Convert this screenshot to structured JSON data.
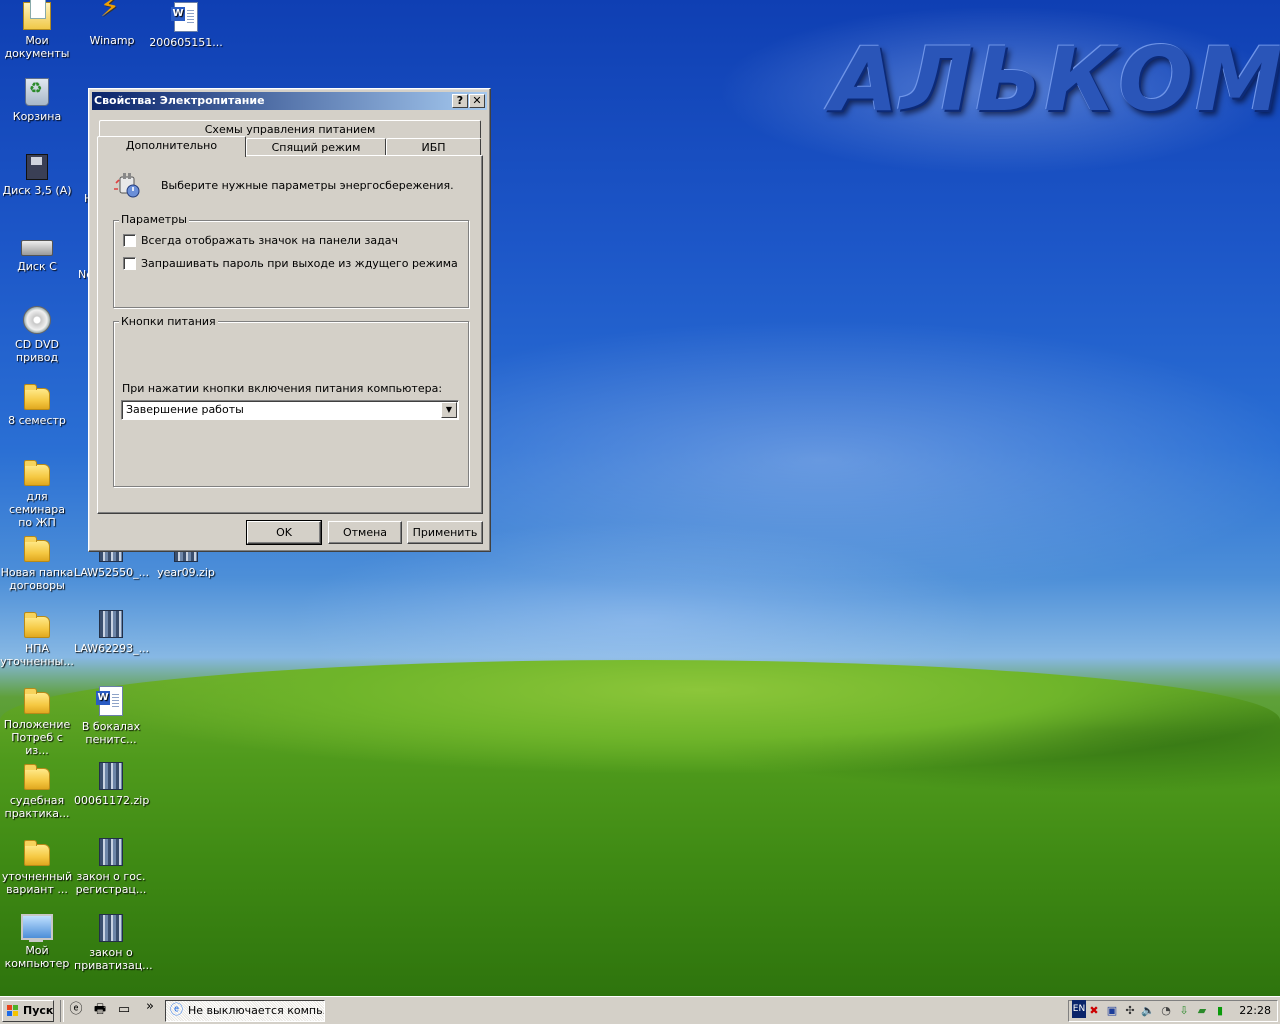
{
  "desktop": {
    "brand_text": "АЛЬКОМ",
    "icons": [
      {
        "label": "Мои\nдокументы",
        "icon": "my-documents-icon"
      },
      {
        "label": "Winamp",
        "icon": "winamp-icon"
      },
      {
        "label": "200605151...",
        "icon": "word-document-icon"
      },
      {
        "label": "Корзина",
        "icon": "recycle-bin-icon"
      },
      {
        "label": "Диск 3,5 (A)",
        "icon": "floppy-drive-icon"
      },
      {
        "label": "Диск C",
        "icon": "hard-drive-icon"
      },
      {
        "label": "CD DVD\nпривод",
        "icon": "cd-drive-icon"
      },
      {
        "label": "8 семестр",
        "icon": "folder-icon"
      },
      {
        "label": "для семинара\nпо ЖП",
        "icon": "folder-icon"
      },
      {
        "label": "Новая папка\nдоговоры",
        "icon": "folder-icon"
      },
      {
        "label": "LAW52550_...",
        "icon": "archive-icon"
      },
      {
        "label": "year09.zip",
        "icon": "archive-icon"
      },
      {
        "label": "НПА\nуточненны...",
        "icon": "folder-icon"
      },
      {
        "label": "LAW62293_...",
        "icon": "archive-icon"
      },
      {
        "label": "Положение\nПотреб с из...",
        "icon": "folder-icon"
      },
      {
        "label": "В бокалах\nпенитс...",
        "icon": "word-document-icon"
      },
      {
        "label": "судебная\nпрактика...",
        "icon": "folder-icon"
      },
      {
        "label": "00061172.zip",
        "icon": "archive-icon"
      },
      {
        "label": "уточненный\nвариант ...",
        "icon": "folder-icon"
      },
      {
        "label": "закон о гос.\nрегистрац...",
        "icon": "archive-icon"
      },
      {
        "label": "Мой\nкомпьютер",
        "icon": "my-computer-icon"
      },
      {
        "label": "закон о\nприватизац...",
        "icon": "archive-icon"
      }
    ],
    "partial_labels": [
      "Н",
      "Ne"
    ]
  },
  "dialog": {
    "title": "Свойства: Электропитание",
    "help_btn": "?",
    "close_btn": "✕",
    "tabs_back_row": [
      "Схемы управления питанием"
    ],
    "tabs_front_row": [
      "Дополнительно",
      "Спящий режим",
      "ИБП"
    ],
    "active_tab": "Дополнительно",
    "intro_text": "Выберите нужные параметры энергосбережения.",
    "params_group": {
      "label": "Параметры",
      "checkboxes": [
        {
          "label": "Всегда отображать значок на панели задач",
          "checked": false
        },
        {
          "label": "Запрашивать пароль при выходе из ждущего режима",
          "checked": false
        }
      ]
    },
    "power_buttons_group": {
      "label": "Кнопки питания",
      "power_button_prompt": "При нажатии кнопки включения питания компьютера:",
      "power_button_value": "Завершение работы"
    },
    "buttons": {
      "ok": "OK",
      "cancel": "Отмена",
      "apply": "Применить"
    }
  },
  "taskbar": {
    "start_label": "Пуск",
    "chevron": "»",
    "active_task": "Не выключается компь...",
    "language": "EN",
    "clock": "22:28"
  }
}
